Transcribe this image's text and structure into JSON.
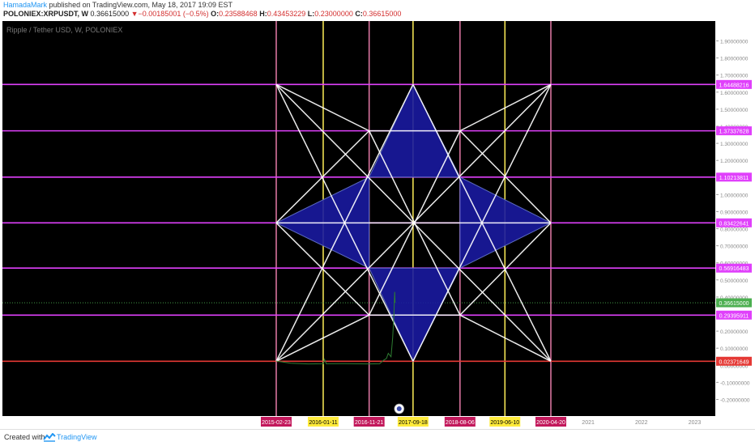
{
  "header": {
    "author": "HamadaMark",
    "published": "published on TradingView.com, May 18, 2017 19:09 EST",
    "symbol": "POLONIEX:XRPUSDT, W",
    "price": "0.36615000",
    "change": "−0.00185001 (−0.5%)",
    "o_label": "O:",
    "o_value": "0.23588468",
    "h_label": "H:",
    "h_value": "0.43453229",
    "l_label": "L:",
    "l_value": "0.23000000",
    "c_label": "C:",
    "c_value": "0.36615000"
  },
  "footer": {
    "created_with": "Created with",
    "brand": "TradingView"
  },
  "chart_data": {
    "type": "line",
    "title": "Ripple / Tether USD, W, POLONIEX",
    "background": "#000000",
    "ylim": [
      -0.25,
      1.95
    ],
    "y_ticks": [
      "1.90000000",
      "1.80000000",
      "1.70000000",
      "1.60000000",
      "1.50000000",
      "1.40000000",
      "1.30000000",
      "1.20000000",
      "1.10000000",
      "1.00000000",
      "0.90000000",
      "0.80000000",
      "0.70000000",
      "0.60000000",
      "0.50000000",
      "0.40000000",
      "0.30000000",
      "0.20000000",
      "0.10000000",
      "0.00000000",
      "-0.10000000",
      "-0.20000000"
    ],
    "y_tick_values": [
      1.9,
      1.8,
      1.7,
      1.6,
      1.5,
      1.4,
      1.3,
      1.2,
      1.1,
      1.0,
      0.9,
      0.8,
      0.7,
      0.6,
      0.5,
      0.4,
      0.3,
      0.2,
      0.1,
      0.0,
      -0.1,
      -0.2
    ],
    "x_range": [
      "2014-01-01",
      "2023-12-31"
    ],
    "x_ticks": [
      {
        "date": "2021-01-01",
        "label": "2021"
      },
      {
        "date": "2022-01-01",
        "label": "2022"
      },
      {
        "date": "2023-01-01",
        "label": "2023"
      }
    ],
    "price_series": {
      "name": "XRPUSDT",
      "color": "#2e7d32",
      "points": [
        [
          "2015-02-23",
          0.025
        ],
        [
          "2015-06-01",
          0.012
        ],
        [
          "2015-10-01",
          0.008
        ],
        [
          "2016-01-11",
          0.009
        ],
        [
          "2016-01-20",
          0.035
        ],
        [
          "2016-02-01",
          0.009
        ],
        [
          "2016-06-01",
          0.01
        ],
        [
          "2016-11-21",
          0.008
        ],
        [
          "2017-02-01",
          0.009
        ],
        [
          "2017-03-01",
          0.03
        ],
        [
          "2017-03-20",
          0.04
        ],
        [
          "2017-04-01",
          0.07
        ],
        [
          "2017-04-20",
          0.05
        ],
        [
          "2017-05-01",
          0.16
        ],
        [
          "2017-05-10",
          0.3
        ],
        [
          "2017-05-15",
          0.43
        ],
        [
          "2017-05-18",
          0.366
        ]
      ]
    },
    "horizontal_levels": [
      {
        "value": 1.64488216,
        "label": "1.64488216",
        "color": "#e040fb"
      },
      {
        "value": 1.37337628,
        "label": "1.37337628",
        "color": "#e040fb"
      },
      {
        "value": 1.10213811,
        "label": "1.10213811",
        "color": "#e040fb"
      },
      {
        "value": 0.83422641,
        "label": "0.83422641",
        "color": "#e040fb"
      },
      {
        "value": 0.56916483,
        "label": "0.56916483",
        "color": "#e040fb"
      },
      {
        "value": 0.29395911,
        "label": "0.29395911",
        "color": "#e040fb"
      },
      {
        "value": 0.02371649,
        "label": "0.02371649",
        "color": "#e53935"
      }
    ],
    "current_price": {
      "value": 0.36615,
      "label": "0.36615000",
      "color": "#4caf50"
    },
    "vertical_levels": [
      {
        "date": "2015-02-23",
        "label": "2015-02-23",
        "color": "#e57aa8",
        "label_bg": "#c2185b"
      },
      {
        "date": "2016-01-11",
        "label": "2016-01-11",
        "color": "#ffee58",
        "label_bg": "#ffeb3b"
      },
      {
        "date": "2016-11-21",
        "label": "2016-11-21",
        "color": "#e57aa8",
        "label_bg": "#c2185b"
      },
      {
        "date": "2017-09-18",
        "label": "2017-09-18",
        "color": "#ffee58",
        "label_bg": "#ffeb3b"
      },
      {
        "date": "2018-08-06",
        "label": "2018-08-06",
        "color": "#e57aa8",
        "label_bg": "#c2185b"
      },
      {
        "date": "2019-06-10",
        "label": "2019-06-10",
        "color": "#ffee58",
        "label_bg": "#ffeb3b"
      },
      {
        "date": "2020-04-20",
        "label": "2020-04-20",
        "color": "#e57aa8",
        "label_bg": "#c2185b"
      }
    ],
    "geometry": {
      "line_color": "#ffffff",
      "fill_color": "#1a1aa0",
      "segments": [
        [
          [
            "2015-02-23",
            1.64488216
          ],
          [
            "2020-04-20",
            0.02371649
          ]
        ],
        [
          [
            "2020-04-20",
            1.64488216
          ],
          [
            "2015-02-23",
            0.02371649
          ]
        ],
        [
          [
            "2015-02-23",
            1.64488216
          ],
          [
            "2016-11-21",
            1.37337628
          ]
        ],
        [
          [
            "2016-11-21",
            1.37337628
          ],
          [
            "2018-08-06",
            1.37337628
          ]
        ],
        [
          [
            "2018-08-06",
            1.37337628
          ],
          [
            "2020-04-20",
            1.64488216
          ]
        ],
        [
          [
            "2015-02-23",
            1.64488216
          ],
          [
            "2017-09-18",
            0.02371649
          ]
        ],
        [
          [
            "2020-04-20",
            1.64488216
          ],
          [
            "2017-09-18",
            0.02371649
          ]
        ],
        [
          [
            "2015-02-23",
            0.02371649
          ],
          [
            "2017-09-18",
            1.64488216
          ]
        ],
        [
          [
            "2020-04-20",
            0.02371649
          ],
          [
            "2017-09-18",
            1.64488216
          ]
        ],
        [
          [
            "2015-02-23",
            0.02371649
          ],
          [
            "2016-11-21",
            0.29395911
          ]
        ],
        [
          [
            "2016-11-21",
            0.29395911
          ],
          [
            "2018-08-06",
            0.29395911
          ]
        ],
        [
          [
            "2018-08-06",
            0.29395911
          ],
          [
            "2020-04-20",
            0.02371649
          ]
        ],
        [
          [
            "2015-02-23",
            0.83422641
          ],
          [
            "2016-11-21",
            1.37337628
          ]
        ],
        [
          [
            "2015-02-23",
            0.83422641
          ],
          [
            "2016-11-21",
            0.29395911
          ]
        ],
        [
          [
            "2020-04-20",
            0.83422641
          ],
          [
            "2018-08-06",
            1.37337628
          ]
        ],
        [
          [
            "2020-04-20",
            0.83422641
          ],
          [
            "2018-08-06",
            0.29395911
          ]
        ],
        [
          [
            "2016-11-21",
            1.37337628
          ],
          [
            "2018-08-06",
            0.29395911
          ]
        ],
        [
          [
            "2018-08-06",
            1.37337628
          ],
          [
            "2016-11-21",
            0.29395911
          ]
        ],
        [
          [
            "2015-02-23",
            0.83422641
          ],
          [
            "2020-04-20",
            0.83422641
          ]
        ]
      ],
      "triangles": [
        [
          [
            "2017-09-18",
            1.64488216
          ],
          [
            "2016-11-21",
            1.10213811
          ],
          [
            "2018-08-06",
            1.10213811
          ]
        ],
        [
          [
            "2015-02-23",
            0.83422641
          ],
          [
            "2016-11-21",
            1.10213811
          ],
          [
            "2016-11-21",
            0.56916483
          ]
        ],
        [
          [
            "2020-04-20",
            0.83422641
          ],
          [
            "2018-08-06",
            1.10213811
          ],
          [
            "2018-08-06",
            0.56916483
          ]
        ],
        [
          [
            "2017-09-18",
            0.02371649
          ],
          [
            "2016-11-21",
            0.56916483
          ],
          [
            "2018-08-06",
            0.56916483
          ]
        ]
      ]
    }
  }
}
